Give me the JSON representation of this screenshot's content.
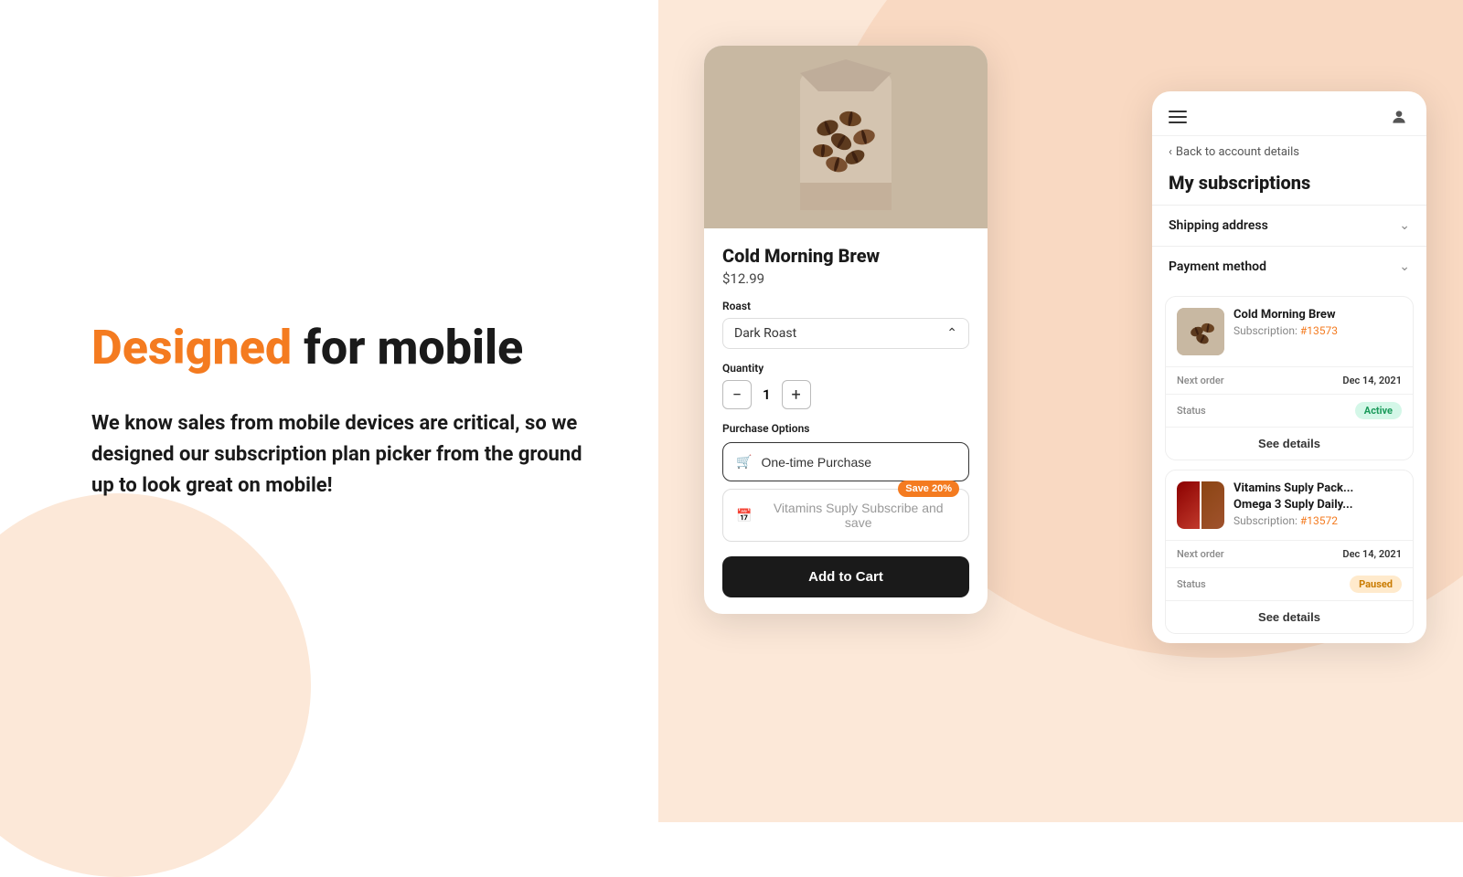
{
  "left": {
    "title_highlight": "Designed",
    "title_rest": " for mobile",
    "body": "We know sales from mobile devices are critical, so we designed our subscription plan picker from the ground up to look great on mobile!"
  },
  "product_card": {
    "product_name": "Cold Morning Brew",
    "price": "$12.99",
    "roast_label": "Roast",
    "roast_value": "Dark Roast",
    "quantity_label": "Quantity",
    "quantity_value": "1",
    "purchase_options_label": "Purchase Options",
    "one_time_label": "One-time Purchase",
    "subscribe_label": "Vitamins Suply Subscribe and save",
    "save_badge": "Save 20%",
    "cart_btn": "Add to Cart"
  },
  "subs_panel": {
    "back_label": "Back to account details",
    "title": "My subscriptions",
    "shipping_label": "Shipping address",
    "payment_label": "Payment method",
    "subscriptions": [
      {
        "name": "Cold Morning Brew",
        "sub_text": "Subscription: ",
        "sub_number": "#13573",
        "next_order_label": "Next order",
        "next_order_value": "Dec 14, 2021",
        "status_label": "Status",
        "status_value": "Active",
        "status_type": "active",
        "see_details": "See details"
      },
      {
        "name": "Vitamins Suply Pack...\nOmega 3 Suply Daily...",
        "name_line1": "Vitamins Suply Pack...",
        "name_line2": "Omega 3 Suply Daily...",
        "sub_text": "Subscription: ",
        "sub_number": "#13572",
        "next_order_label": "Next order",
        "next_order_value": "Dec 14, 2021",
        "status_label": "Status",
        "status_value": "Paused",
        "status_type": "paused",
        "see_details": "See details"
      }
    ]
  }
}
